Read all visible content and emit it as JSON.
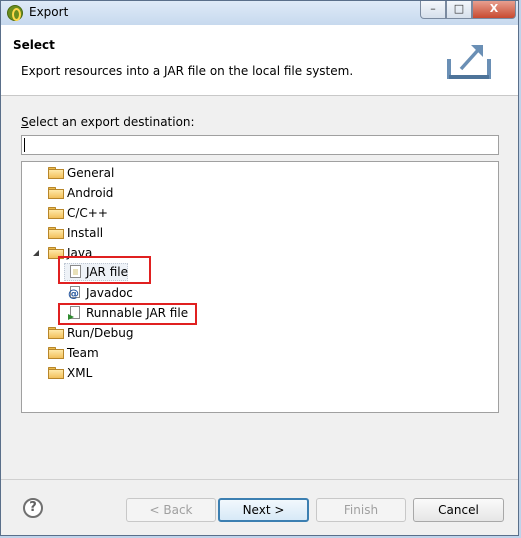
{
  "window": {
    "title": "Export",
    "controls": {
      "minimize": "–",
      "maximize": "□",
      "close": "X"
    }
  },
  "header": {
    "title": "Select",
    "description": "Export resources into a JAR file on the local file system.",
    "icon": "export-wizard-icon"
  },
  "destination": {
    "label": "Select an export destination:",
    "filter_value": "",
    "filter_placeholder": ""
  },
  "tree": {
    "items": [
      {
        "label": "General",
        "icon": "folder-icon",
        "state": "collapsed"
      },
      {
        "label": "Android",
        "icon": "folder-icon",
        "state": "collapsed"
      },
      {
        "label": "C/C++",
        "icon": "folder-icon",
        "state": "collapsed"
      },
      {
        "label": "Install",
        "icon": "folder-icon",
        "state": "collapsed"
      },
      {
        "label": "Java",
        "icon": "folder-icon",
        "state": "expanded",
        "children": [
          {
            "label": "JAR file",
            "icon": "jar-file-icon",
            "selected": true,
            "highlighted": true
          },
          {
            "label": "Javadoc",
            "icon": "javadoc-icon"
          },
          {
            "label": "Runnable JAR file",
            "icon": "runnable-jar-icon",
            "highlighted": true
          }
        ]
      },
      {
        "label": "Run/Debug",
        "icon": "folder-icon",
        "state": "collapsed"
      },
      {
        "label": "Team",
        "icon": "folder-icon",
        "state": "collapsed"
      },
      {
        "label": "XML",
        "icon": "folder-icon",
        "state": "collapsed"
      }
    ]
  },
  "buttons": {
    "help": "?",
    "back": "< Back",
    "next": "Next >",
    "finish": "Finish",
    "cancel": "Cancel"
  },
  "colors": {
    "highlight_box": "#e02020",
    "default_button_border": "#3c7fb1"
  }
}
